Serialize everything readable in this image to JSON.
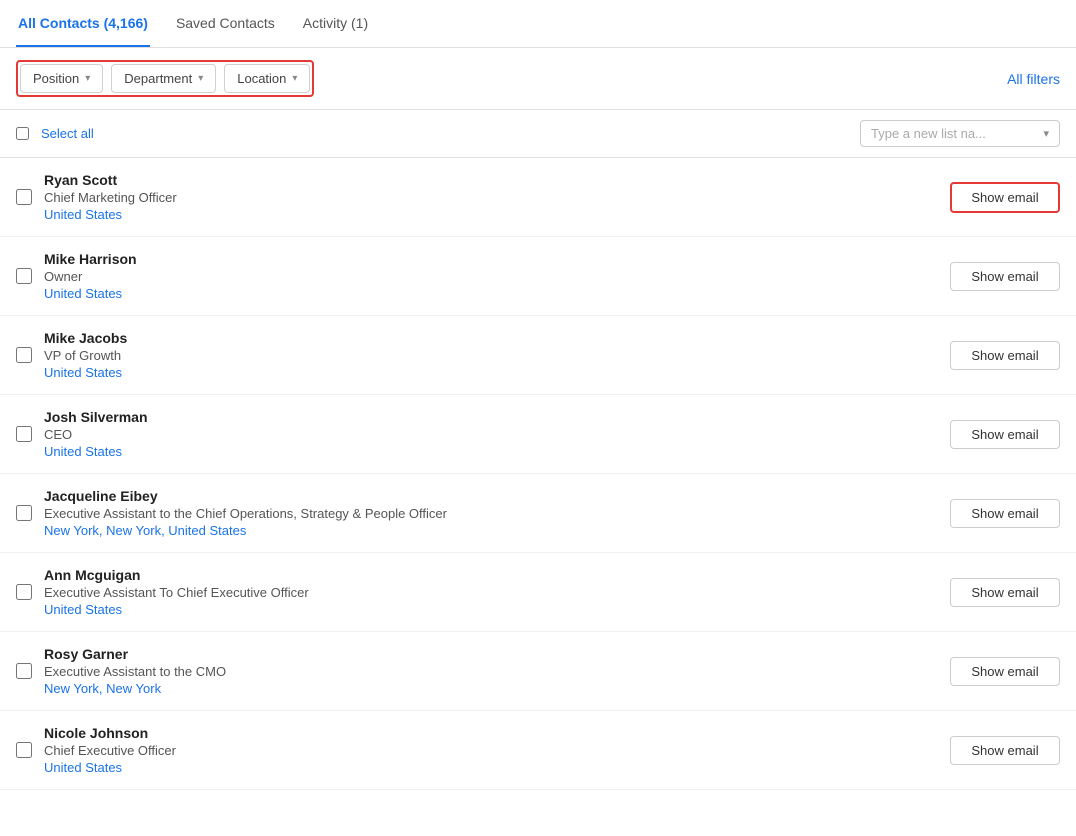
{
  "tabs": [
    {
      "id": "all-contacts",
      "label": "All Contacts (4,166)",
      "active": true
    },
    {
      "id": "saved-contacts",
      "label": "Saved Contacts",
      "active": false
    },
    {
      "id": "activity",
      "label": "Activity (1)",
      "active": false
    }
  ],
  "filters": {
    "position": {
      "label": "Position",
      "chevron": "▾"
    },
    "department": {
      "label": "Department",
      "chevron": "▾"
    },
    "location": {
      "label": "Location",
      "chevron": "▾"
    },
    "all_filters": "All filters"
  },
  "list_header": {
    "select_all": "Select all",
    "list_name_placeholder": "Type a new list na...",
    "chevron": "▾"
  },
  "show_email_label": "Show email",
  "contacts": [
    {
      "id": 1,
      "name": "Ryan Scott",
      "title": "Chief Marketing Officer",
      "location": "United States",
      "highlighted": true
    },
    {
      "id": 2,
      "name": "Mike Harrison",
      "title": "Owner",
      "location": "United States",
      "highlighted": false
    },
    {
      "id": 3,
      "name": "Mike Jacobs",
      "title": "VP of Growth",
      "location": "United States",
      "highlighted": false
    },
    {
      "id": 4,
      "name": "Josh Silverman",
      "title": "CEO",
      "location": "United States",
      "highlighted": false
    },
    {
      "id": 5,
      "name": "Jacqueline Eibey",
      "title": "Executive Assistant to the Chief Operations, Strategy & People Officer",
      "location": "New York, New York, United States",
      "highlighted": false
    },
    {
      "id": 6,
      "name": "Ann Mcguigan",
      "title": "Executive Assistant To Chief Executive Officer",
      "location": "United States",
      "highlighted": false
    },
    {
      "id": 7,
      "name": "Rosy Garner",
      "title": "Executive Assistant to the CMO",
      "location": "New York, New York",
      "highlighted": false
    },
    {
      "id": 8,
      "name": "Nicole Johnson",
      "title": "Chief Executive Officer",
      "location": "United States",
      "highlighted": false
    }
  ]
}
